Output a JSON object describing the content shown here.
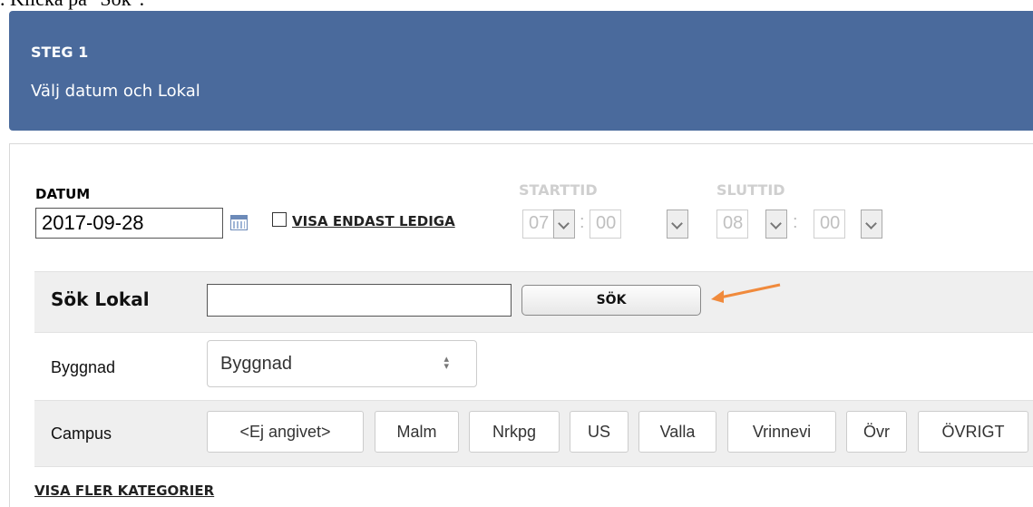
{
  "caption": ". Klicka på \"Sök\".",
  "step": {
    "title": "STEG 1",
    "subtitle": "Välj datum och Lokal"
  },
  "date": {
    "label": "DATUM",
    "value": "2017-09-28"
  },
  "filter": {
    "visa_endast_lediga": "VISA ENDAST LEDIGA",
    "checked": false
  },
  "time": {
    "starttid_label": "STARTTID",
    "start_hour": "07",
    "start_min": "00",
    "sluttid_label": "SLUTTID",
    "end_hour": "08",
    "end_min": "00"
  },
  "search": {
    "label": "Sök Lokal",
    "value": "",
    "button": "SÖK"
  },
  "building": {
    "label": "Byggnad",
    "selected": "Byggnad"
  },
  "campus": {
    "label": "Campus",
    "options": [
      "<Ej angivet>",
      "Malm",
      "Nrkpg",
      "US",
      "Valla",
      "Vrinnevi",
      "Övr",
      "ÖVRIGT"
    ]
  },
  "more_categories": "VISA FLER KATEGORIER",
  "colors": {
    "header_bg": "#4a6a9c",
    "arrow": "#f08a3c"
  }
}
